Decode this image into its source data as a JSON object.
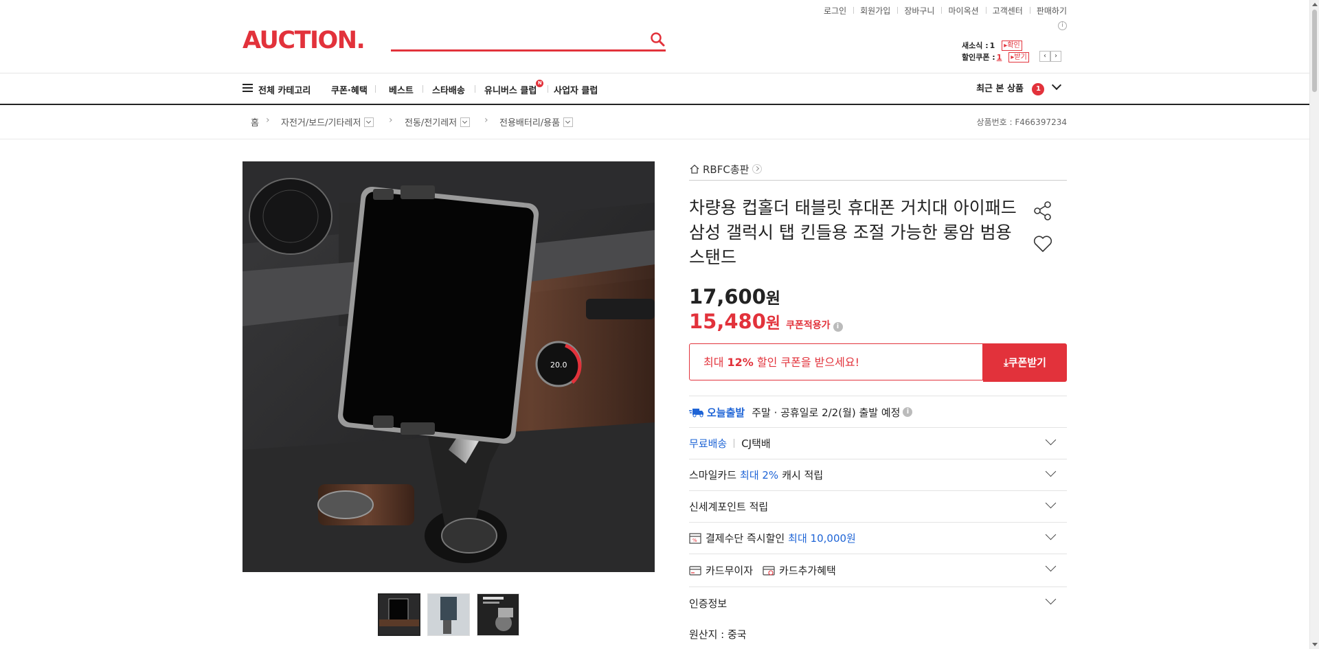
{
  "header": {
    "util_links": [
      "로그인",
      "회원가입",
      "장바구니",
      "마이옥션",
      "고객센터",
      "판매하기"
    ],
    "logo": "AUCTION.",
    "search": {
      "placeholder": "",
      "value": ""
    },
    "mini": {
      "new_news_label": "새소식 :",
      "new_news_count": "1",
      "new_news_btn": "확인",
      "coupon_label": "할인쿠폰 :",
      "coupon_count": "1",
      "coupon_btn": "받기"
    }
  },
  "nav": {
    "all_category": "전체 카테고리",
    "items": [
      "쿠폰·혜택",
      "베스트",
      "스타배송",
      "유니버스 클럽",
      "사업자 클럽"
    ],
    "new_badge": "N",
    "recent_label": "최근 본 상품",
    "recent_count": "1"
  },
  "breadcrumb": {
    "home": "홈",
    "items": [
      "자전거/보드/기타레저",
      "전동/전기레저",
      "전용배터리/용품"
    ],
    "product_no": "상품번호 : F466397234"
  },
  "product": {
    "shop_name": "RBFC총판",
    "title": "차량용 컵홀더 태블릿 휴대폰 거치대 아이패드 삼성 갤럭시 탭 킨들용 조절 가능한 롱암 범용 스탠드",
    "price_original": "17,600",
    "price_sale": "15,480",
    "currency": "원",
    "coupon_applied": "쿠폰적용가",
    "coupon_box_prefix": "최대 ",
    "coupon_box_pct": "12%",
    "coupon_box_suffix": " 할인 쿠폰을 받으세요!",
    "coupon_btn": "쿠폰받기",
    "today_ship": "오늘출발",
    "ship_note": "주말 · 공휴일로 2/2(월) 출발 예정",
    "rows": {
      "free_ship": "무료배송",
      "courier": "CJ택배",
      "smile_a": "스마일카드 ",
      "smile_b": "최대 2%",
      "smile_c": " 캐시 적립",
      "ssg": "신세계포인트 적립",
      "pay_a": "결제수단 즉시할인 ",
      "pay_b": "최대 10,000원",
      "card_free": "카드무이자",
      "card_extra": "카드추가혜택",
      "cert": "인증정보"
    },
    "origin": "원산지 : 중국"
  },
  "colors": {
    "brand": "#e2323b",
    "accent_blue": "#1e64d6"
  }
}
